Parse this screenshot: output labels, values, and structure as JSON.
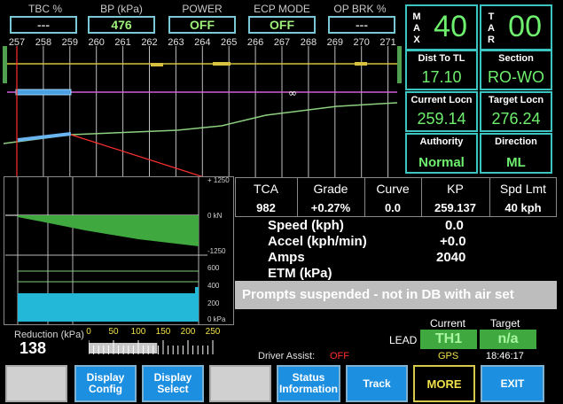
{
  "gauges": [
    {
      "label": "TBC %",
      "value": "---"
    },
    {
      "label": "BP (kPa)",
      "value": "476"
    },
    {
      "label": "POWER",
      "value": "OFF"
    },
    {
      "label": "ECP MODE",
      "value": "OFF"
    },
    {
      "label": "OP BRK %",
      "value": "---"
    }
  ],
  "km_marks": [
    "257",
    "258",
    "259",
    "260",
    "261",
    "262",
    "263",
    "264",
    "265",
    "266",
    "267",
    "268",
    "269",
    "270",
    "271",
    "272"
  ],
  "infinity_symbol": "∞",
  "right_panel": {
    "max_label": "MAX",
    "max_value": "40",
    "tar_label": "TAR",
    "tar_value": "00",
    "dist_label": "Dist To TL",
    "dist_value": "17.10",
    "section_label": "Section",
    "section_value": "RO-WO",
    "current_locn_label": "Current Locn",
    "current_locn_value": "259.14",
    "target_locn_label": "Target Locn",
    "target_locn_value": "276.24",
    "authority_label": "Authority",
    "authority_value": "Normal",
    "direction_label": "Direction",
    "direction_value": "ML"
  },
  "force_chart": {
    "ticks": [
      "+ 1250",
      "0 kN",
      "-1250"
    ]
  },
  "pressure_chart": {
    "ticks": [
      "600",
      "400",
      "200",
      "0 kPa"
    ]
  },
  "table": {
    "headers": [
      "TCA",
      "Grade",
      "Curve",
      "KP",
      "Spd Lmt"
    ],
    "values": [
      "982",
      "+0.27%",
      "0.0",
      "259.137",
      "40 kph"
    ]
  },
  "readouts": {
    "speed_label": "Speed  (kph)",
    "speed_value": "0.0",
    "accel_label": "Accel (kph/min)",
    "accel_value": "+0.0",
    "amps_label": "Amps",
    "amps_value": "2040",
    "etm_label": "ETM (kPa)"
  },
  "prompt": "Prompts suspended  - not in DB with air set",
  "reduction": {
    "label": "Reduction (kPa)",
    "value": "138",
    "scale": [
      "0",
      "50",
      "100",
      "150",
      "200",
      "250"
    ],
    "level_kpa": 138
  },
  "driver_assist": {
    "label": "Driver Assist:",
    "value": "OFF"
  },
  "lead": {
    "label": "LEAD",
    "current_header": "Current",
    "target_header": "Target",
    "current_value": "TH1",
    "target_value": "n/a",
    "gps": "GPS",
    "time": "18:46:17"
  },
  "buttons": {
    "display_config": "Display\nConfig",
    "display_select": "Display\nSelect",
    "status_info": "Status\nInformation",
    "track": "Track",
    "more": "MORE",
    "exit": "EXIT"
  },
  "colors": {
    "accent_green": "#6ef06e",
    "border_cyan": "#3cc4c0",
    "button_blue": "#1c8fe0",
    "more_yellow": "#f0e04a",
    "alert_red": "#ff3030"
  }
}
